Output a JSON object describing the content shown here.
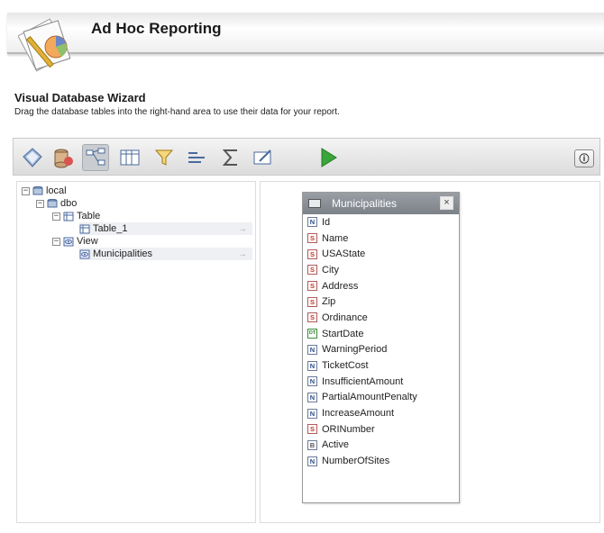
{
  "header": {
    "title": "Ad Hoc Reporting"
  },
  "wizard": {
    "title": "Visual Database Wizard",
    "description": "Drag the database tables into the right-hand area to use their data for your report."
  },
  "toolbar": {
    "buttons": [
      {
        "name": "data-source-icon"
      },
      {
        "name": "data-sources-icon"
      },
      {
        "name": "relationships-icon"
      },
      {
        "name": "fields-icon"
      },
      {
        "name": "filter-icon"
      },
      {
        "name": "sort-icon"
      },
      {
        "name": "sigma-icon"
      },
      {
        "name": "format-icon"
      },
      {
        "name": "run-icon"
      }
    ],
    "info_label": "ⓘ"
  },
  "tree": {
    "local": "local",
    "dbo": "dbo",
    "table_group": "Table",
    "table_1": "Table_1",
    "view_group": "View",
    "municipalities": "Municipalities",
    "drag_arrow": "→"
  },
  "table_widget": {
    "title": "Municipalities",
    "close": "×",
    "fields": [
      {
        "type": "N",
        "name": "Id"
      },
      {
        "type": "S",
        "name": "Name"
      },
      {
        "type": "S",
        "name": "USAState"
      },
      {
        "type": "S",
        "name": "City"
      },
      {
        "type": "S",
        "name": "Address"
      },
      {
        "type": "S",
        "name": "Zip"
      },
      {
        "type": "S",
        "name": "Ordinance"
      },
      {
        "type": "DT",
        "name": "StartDate"
      },
      {
        "type": "N",
        "name": "WarningPeriod"
      },
      {
        "type": "N",
        "name": "TicketCost"
      },
      {
        "type": "N",
        "name": "InsufficientAmount"
      },
      {
        "type": "N",
        "name": "PartialAmountPenalty"
      },
      {
        "type": "N",
        "name": "IncreaseAmount"
      },
      {
        "type": "S",
        "name": "ORINumber"
      },
      {
        "type": "B",
        "name": "Active"
      },
      {
        "type": "N",
        "name": "NumberOfSites"
      }
    ]
  },
  "colors": {
    "run_green": "#3aa63a",
    "header_bar": "#8a8f96"
  }
}
